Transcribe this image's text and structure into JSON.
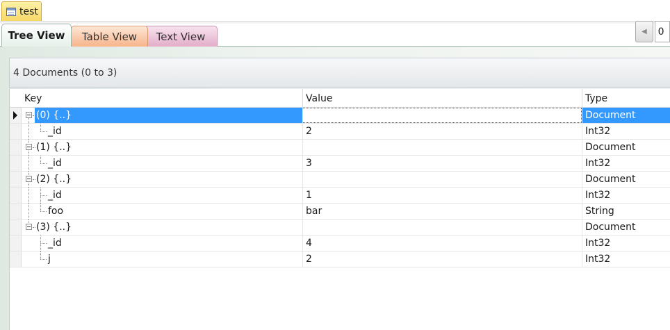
{
  "document_tab": {
    "label": "test",
    "icon": "table-icon"
  },
  "view_tabs": [
    {
      "label": "Tree View",
      "active": true
    },
    {
      "label": "Table View",
      "active": false
    },
    {
      "label": "Text View",
      "active": false
    }
  ],
  "pager": {
    "prev_icon": "chevron-left-icon",
    "value": "0"
  },
  "summary": "4 Documents (0 to 3)",
  "columns": {
    "key": "Key",
    "value": "Value",
    "type": "Type"
  },
  "rows": [
    {
      "key": "(0) {..}",
      "value": "",
      "type": "Document",
      "level": 0,
      "selected": true
    },
    {
      "key": "_id",
      "value": "2",
      "type": "Int32",
      "level": 1
    },
    {
      "key": "(1) {..}",
      "value": "",
      "type": "Document",
      "level": 0
    },
    {
      "key": "_id",
      "value": "3",
      "type": "Int32",
      "level": 1
    },
    {
      "key": "(2) {..}",
      "value": "",
      "type": "Document",
      "level": 0
    },
    {
      "key": "_id",
      "value": "1",
      "type": "Int32",
      "level": 1
    },
    {
      "key": "foo",
      "value": "bar",
      "type": "String",
      "level": 1
    },
    {
      "key": "(3) {..}",
      "value": "",
      "type": "Document",
      "level": 0
    },
    {
      "key": "_id",
      "value": "4",
      "type": "Int32",
      "level": 1
    },
    {
      "key": "j",
      "value": "2",
      "type": "Int32",
      "level": 1
    }
  ],
  "colors": {
    "selection": "#3399ff",
    "tree_tab": "#e6f1ea",
    "table_tab": "#f7b48b",
    "text_tab": "#e2adc8",
    "doc_tab": "#f7d867"
  }
}
